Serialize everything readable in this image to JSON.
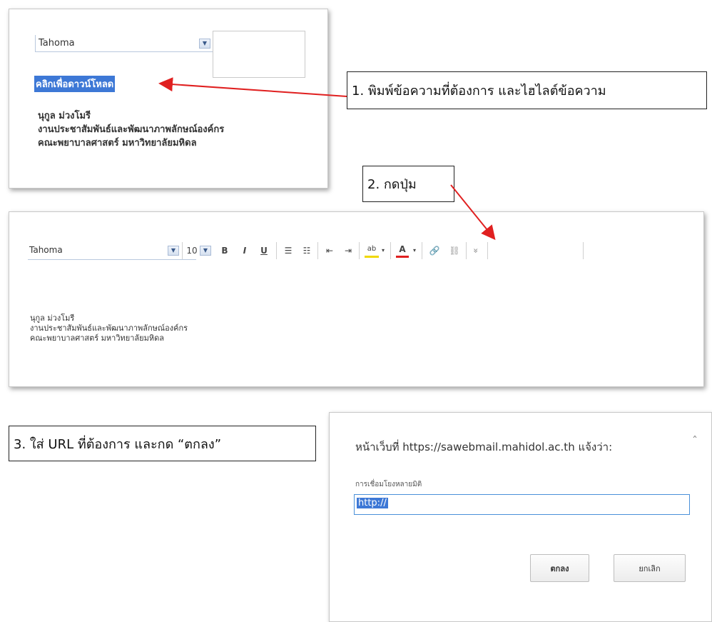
{
  "panel1": {
    "font_name": "Tahoma",
    "selected_link_text": "คลิกเพื่อดาวน์โหลด",
    "signature": [
      "นุกูล ม่วงโมรี",
      "งานประชาสัมพันธ์และพัฒนาภาพลักษณ์องค์กร",
      "คณะพยาบาลศาสตร์ มหาวิทยาลัยมหิดล"
    ]
  },
  "callouts": {
    "step1": "1. พิมพ์ข้อความที่ต้องการ และไฮไลต์ข้อความ",
    "step2": "2. กดปุ่ม",
    "step3": "3. ใส่ URL ที่ต้องการ และกด “ตกลง”"
  },
  "panel2": {
    "font_name": "Tahoma",
    "font_size": "10",
    "buttons": {
      "bold": "B",
      "italic": "I",
      "underline": "U",
      "bullets": "☰",
      "numbering": "☷",
      "outdent": "⇤",
      "indent": "⇥",
      "highlight": "ab",
      "font_color": "A",
      "insert_link": "🔗",
      "remove_link": "⛓",
      "more": "»"
    },
    "signature": [
      "นุกูล ม่วงโมรี",
      "งานประชาสัมพันธ์และพัฒนาภาพลักษณ์องค์กร",
      "คณะพยาบาลศาสตร์ มหาวิทยาลัยมหิดล"
    ]
  },
  "dialog": {
    "title": "หน้าเว็บที่ https://sawebmail.mahidol.ac.th แจ้งว่า:",
    "close_glyph": "ˆ",
    "field_label": "การเชื่อมโยงหลายมิติ",
    "field_value": "http://",
    "ok_label": "ตกลง",
    "cancel_label": "ยกเลิก"
  },
  "colors": {
    "arrow": "#e02020",
    "selection": "#3d78d6"
  }
}
